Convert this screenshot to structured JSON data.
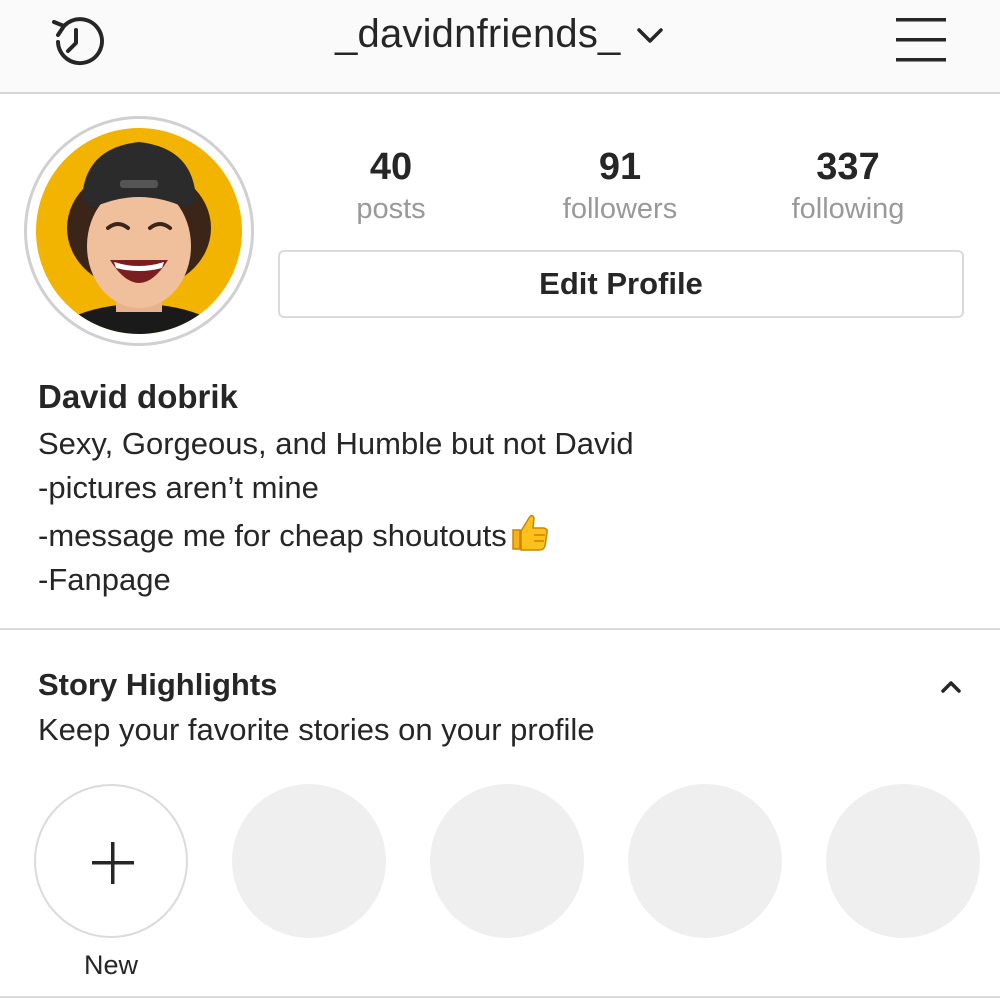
{
  "header": {
    "username": "_davidnfriends_",
    "icons": {
      "left": "history-icon",
      "dropdown": "chevron-down-icon",
      "right": "hamburger-menu-icon"
    }
  },
  "profile": {
    "avatar_icon": "profile-photo",
    "stats": {
      "posts": {
        "value": "40",
        "label": "posts"
      },
      "followers": {
        "value": "91",
        "label": "followers"
      },
      "following": {
        "value": "337",
        "label": "following"
      }
    },
    "edit_button_label": "Edit Profile"
  },
  "bio": {
    "name": "David dobrik",
    "lines": [
      "Sexy, Gorgeous, and Humble but not David",
      "-pictures aren’t mine",
      "-message me for cheap shoutouts",
      "-Fanpage"
    ],
    "emoji_icon": "thumbs-up-emoji-icon"
  },
  "highlights": {
    "title": "Story Highlights",
    "subtitle": "Keep your favorite stories on your profile",
    "new_label": "New",
    "placeholder_count": 4,
    "collapse_icon": "chevron-up-icon"
  },
  "colors": {
    "text": "#262626",
    "muted": "#999999",
    "border": "#dbdbdb",
    "avatar_bg": "#f2b400",
    "placeholder": "#efefef"
  }
}
